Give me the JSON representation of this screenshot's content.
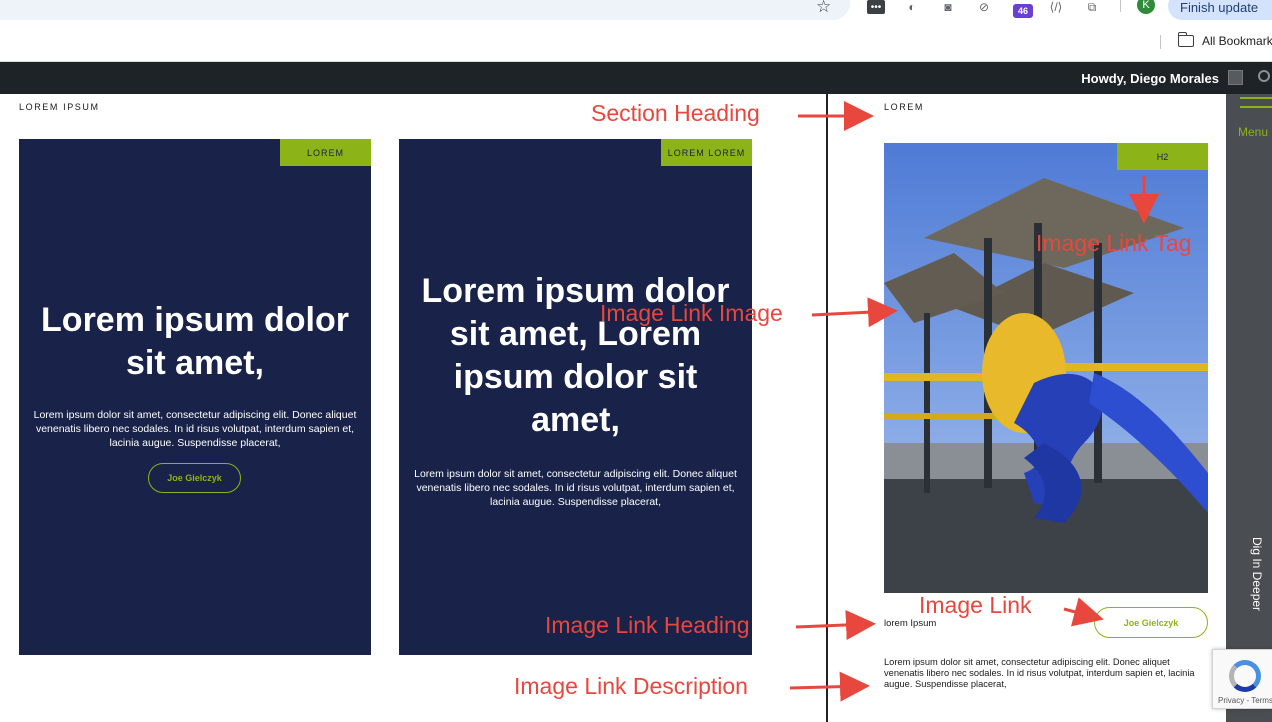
{
  "browser": {
    "extension_badge_count": "46",
    "profile_initial": "K",
    "finish_update_label": "Finish update",
    "bookmarks_label": "All Bookmarks"
  },
  "admin_bar": {
    "greeting": "Howdy, Diego Morales"
  },
  "side_menu": {
    "menu_label": "Menu",
    "dig_deeper_label": "Dig In Deeper"
  },
  "left_section": {
    "heading": "LOREM IPSUM",
    "cards": [
      {
        "tag": "LOREM",
        "title": "Lorem ipsum dolor sit amet,",
        "description": "Lorem ipsum dolor sit amet, consectetur adipiscing elit. Donec aliquet venenatis libero nec sodales. In id risus volutpat, interdum sapien et, lacinia augue. Suspendisse placerat,",
        "button_label": "Joe Gielczyk"
      },
      {
        "tag": "LOREM LOREM",
        "title": "Lorem ipsum dolor sit amet, Lorem ipsum dolor sit amet,",
        "description": "Lorem ipsum dolor sit amet, consectetur adipiscing elit. Donec aliquet venenatis libero nec sodales. In id risus volutpat, interdum sapien et, lacinia augue. Suspendisse placerat,"
      }
    ]
  },
  "right_section": {
    "heading": "LOREM",
    "image_tag": "H2",
    "image_link_heading": "lorem Ipsum",
    "image_link_button": "Joe Gielczyk",
    "image_link_description": "Lorem ipsum dolor sit amet, consectetur adipiscing elit. Donec aliquet venenatis libero nec sodales. In id risus volutpat, interdum sapien et, lacinia augue. Suspendisse placerat,"
  },
  "annotations": {
    "section_heading": "Section Heading",
    "image_link_tag": "Image Link Tag",
    "image_link_image": "Image Link Image",
    "image_link": "Image Link",
    "image_link_heading": "Image Link Heading",
    "image_link_description": "Image Link Description",
    "color": "#e8473d"
  },
  "recaptcha": {
    "footer": "Privacy - Terms"
  },
  "colors": {
    "brand_green": "#8cb318",
    "card_navy": "#192349",
    "admin_bar": "#1e2327",
    "side_menu": "#4a4d51"
  }
}
